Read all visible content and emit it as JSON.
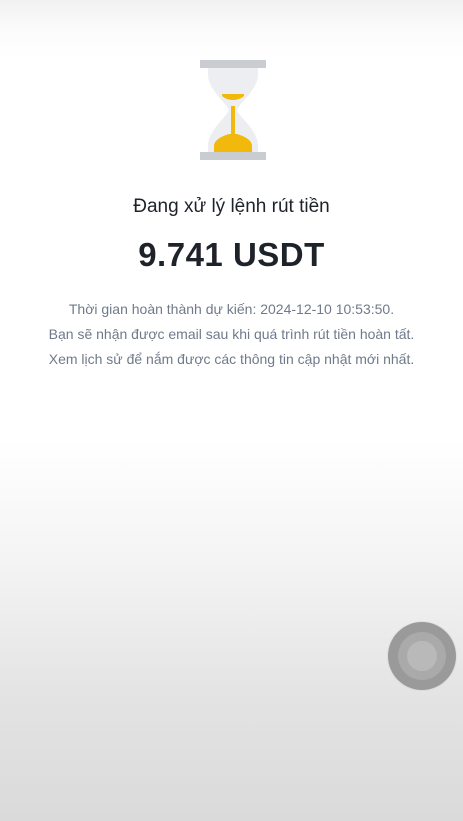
{
  "status": {
    "title": "Đang xử lý lệnh rút tiền",
    "amount": "9.741 USDT",
    "icon": "hourglass-icon",
    "accent_color": "#f0b90b"
  },
  "info": {
    "expected_completion": "Thời gian hoàn thành dự kiến: 2024-12-10 10:53:50.",
    "email_notice": "Bạn sẽ nhận được email sau khi quá trình rút tiền hoàn tất.",
    "history_notice": "Xem lịch sử để nắm được các thông tin cập nhật mới nhất."
  },
  "floating_button": {
    "icon": "assistive-touch-icon"
  }
}
